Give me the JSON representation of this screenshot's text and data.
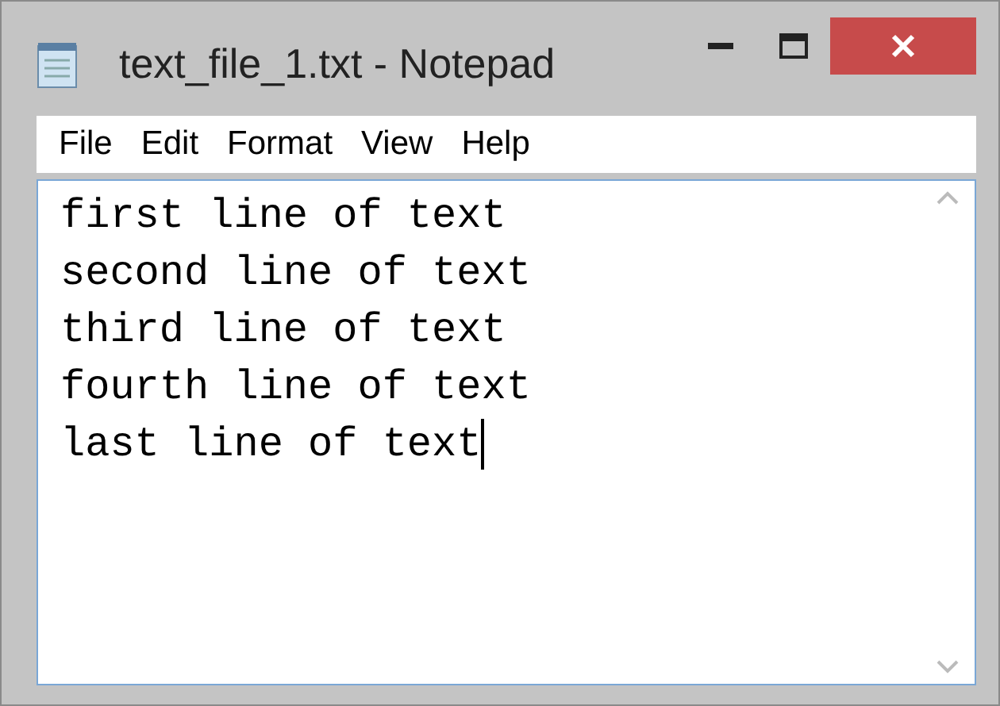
{
  "window": {
    "title": "text_file_1.txt - Notepad"
  },
  "menu": [
    "File",
    "Edit",
    "Format",
    "View",
    "Help"
  ],
  "editor": {
    "lines": [
      "first line of text",
      "second line of text",
      "third line of text",
      "fourth line of text",
      "last line of text"
    ],
    "caret_at_end": true
  }
}
